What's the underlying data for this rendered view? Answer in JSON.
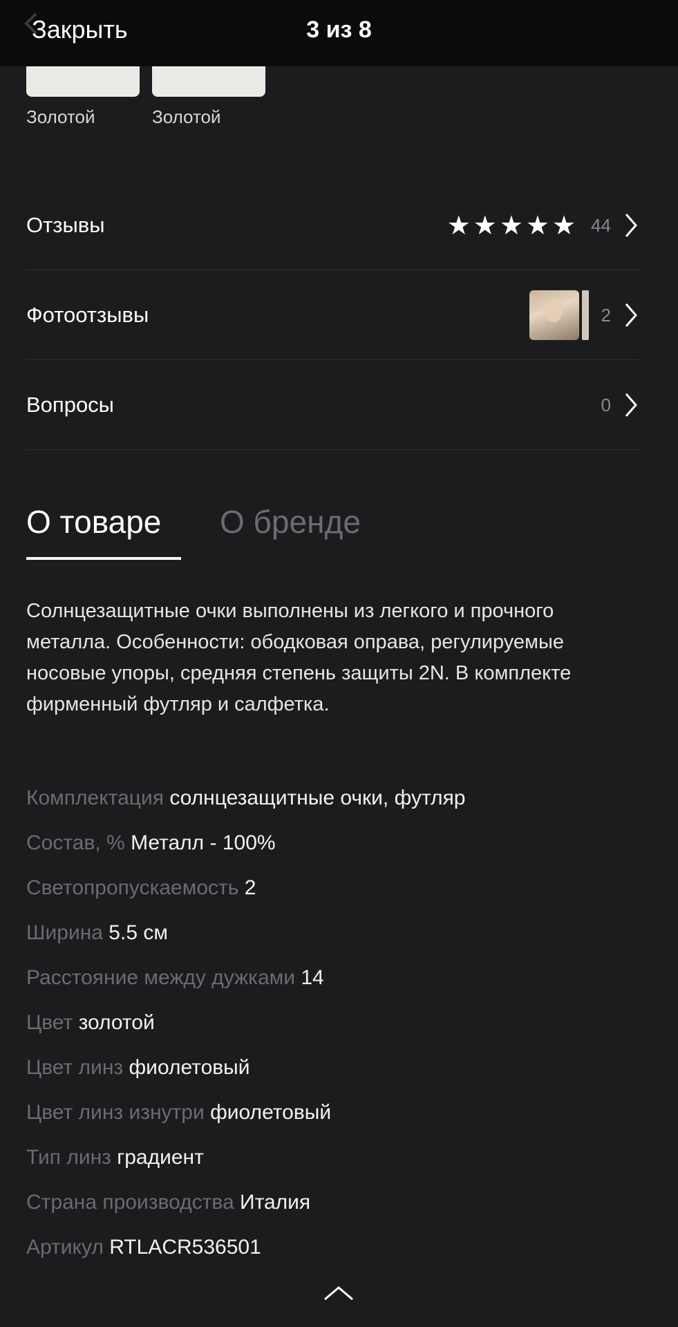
{
  "header": {
    "close_label": "Закрыть",
    "counter": "3 из 8"
  },
  "swatches": [
    {
      "label": "Золотой"
    },
    {
      "label": "Золотой"
    }
  ],
  "rows": {
    "reviews": {
      "label": "Отзывы",
      "stars": "★★★★★",
      "count": "44",
      "rating": 5
    },
    "photo_reviews": {
      "label": "Фотоотзывы",
      "count": "2"
    },
    "questions": {
      "label": "Вопросы",
      "count": "0"
    }
  },
  "tabs": {
    "active": "О товаре",
    "inactive": "О бренде"
  },
  "description": "Солнцезащитные очки выполнены из легкого и прочного металла. Особенности: ободковая оправа, регулируемые носовые упоры, средняя степень защиты 2N. В комплекте фирменный футляр и салфетка.",
  "properties": [
    {
      "key": "Комплектация",
      "value": "солнцезащитные очки, футляр"
    },
    {
      "key": "Состав, %",
      "value": "Металл - 100%"
    },
    {
      "key": "Светопропускаемость",
      "value": "2"
    },
    {
      "key": "Ширина",
      "value": "5.5 см"
    },
    {
      "key": "Расстояние между дужками",
      "value": "14"
    },
    {
      "key": "Цвет",
      "value": "золотой"
    },
    {
      "key": "Цвет линз",
      "value": "фиолетовый"
    },
    {
      "key": "Цвет линз изнутри",
      "value": "фиолетовый"
    },
    {
      "key": "Тип линз",
      "value": "градиент"
    },
    {
      "key": "Страна производства",
      "value": "Италия"
    },
    {
      "key": "Артикул",
      "value": "RTLACR536501"
    }
  ],
  "icons": {
    "back": "chevron-left-icon",
    "chevron": "chevron-right-icon",
    "up": "chevron-up-icon"
  },
  "colors": {
    "background": "#1c1c1e",
    "topbar": "#0b0b0c",
    "muted": "#6b6b70"
  }
}
